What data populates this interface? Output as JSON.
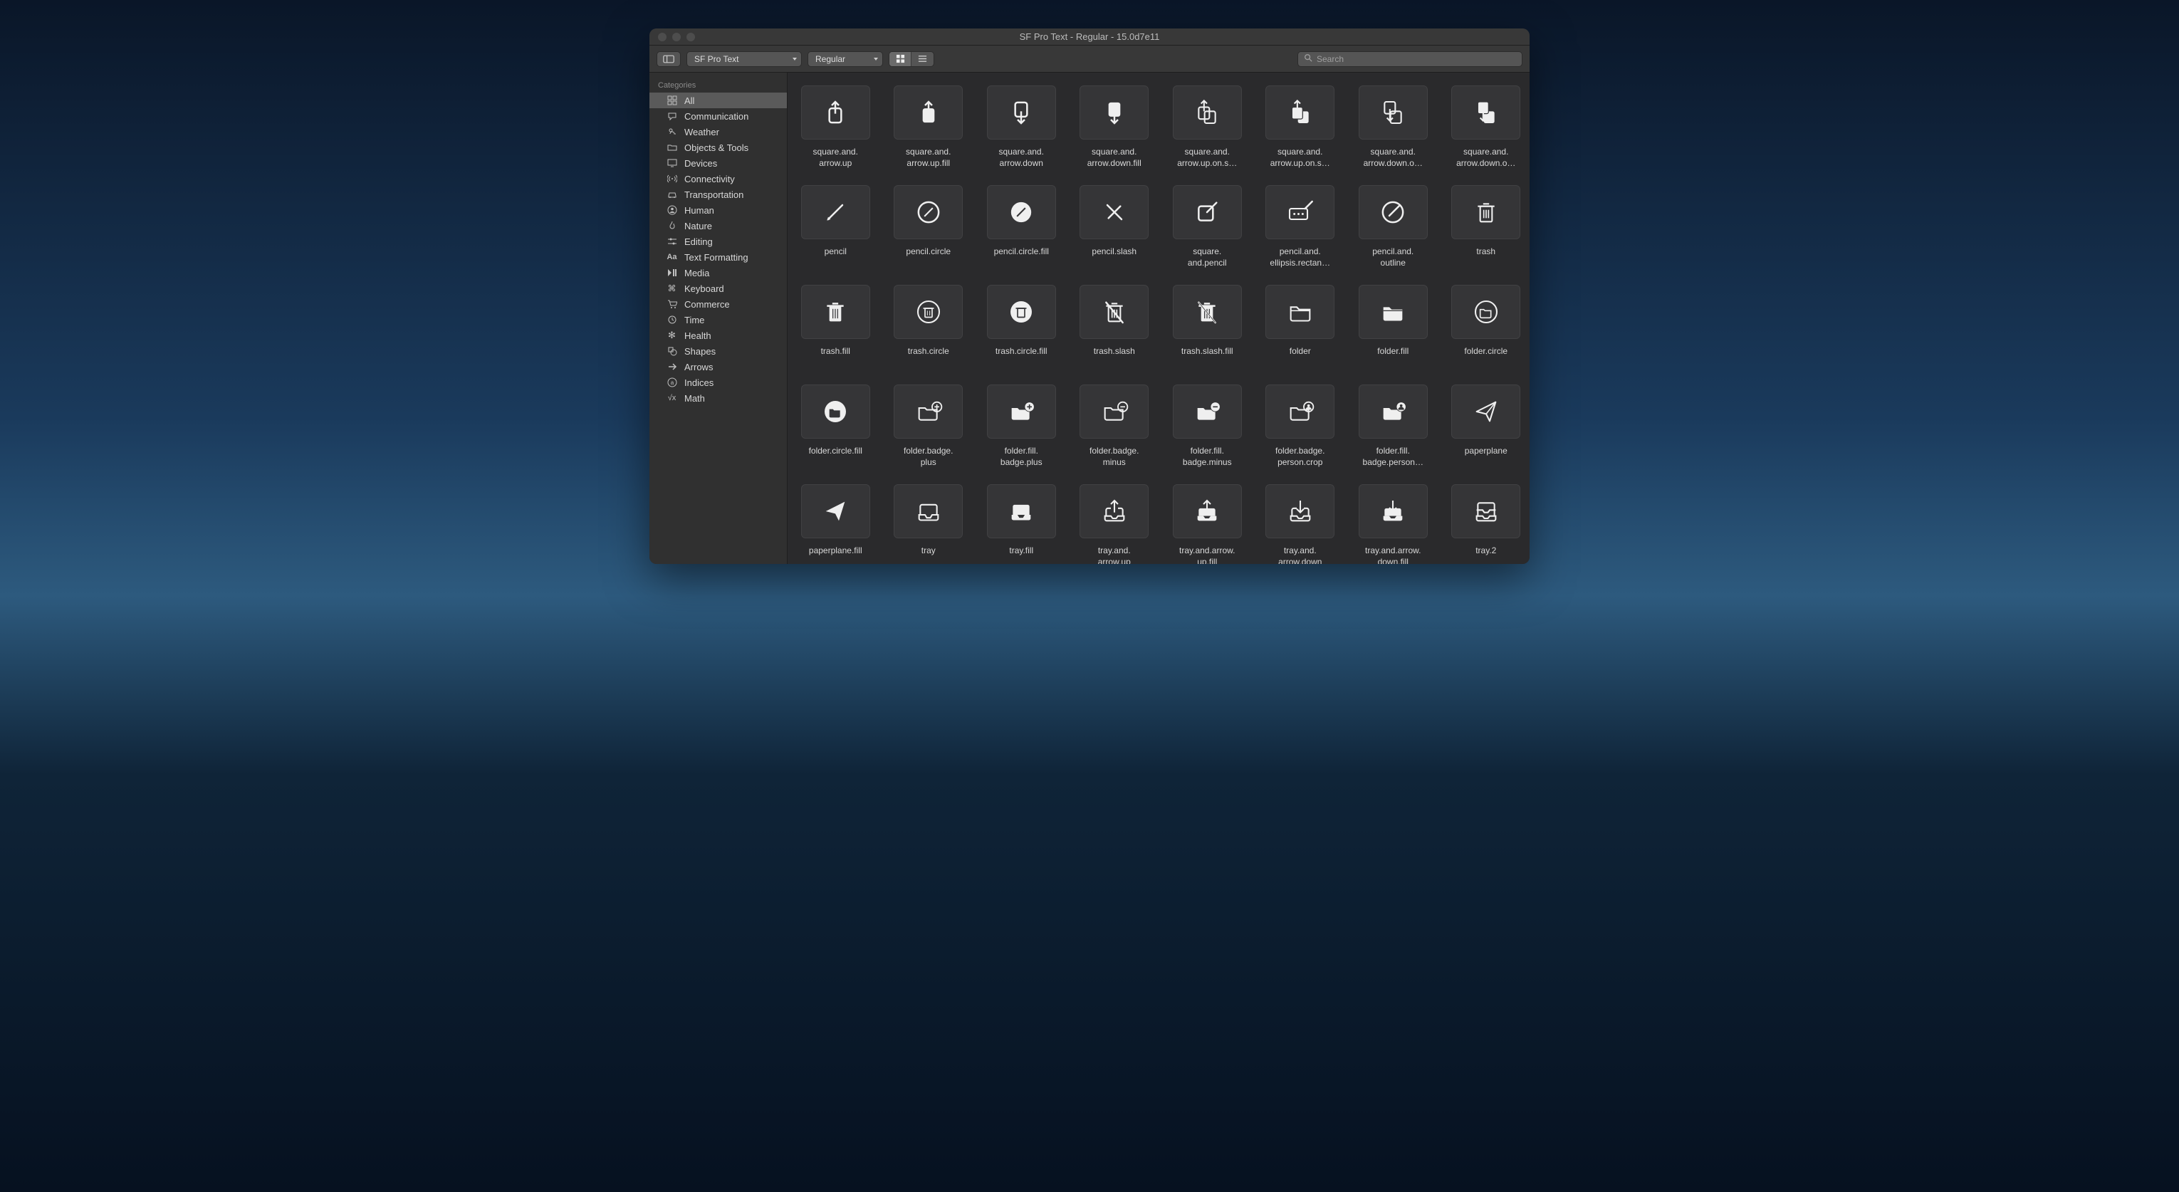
{
  "window_title": "SF Pro Text - Regular - 15.0d7e11",
  "toolbar": {
    "font_select": "SF Pro Text",
    "weight_select": "Regular",
    "search_placeholder": "Search"
  },
  "sidebar": {
    "header": "Categories",
    "items": [
      {
        "label": "All",
        "icon": "grid-icon",
        "active": true
      },
      {
        "label": "Communication",
        "icon": "bubble-icon"
      },
      {
        "label": "Weather",
        "icon": "cloud-sun-icon"
      },
      {
        "label": "Objects & Tools",
        "icon": "folder-icon"
      },
      {
        "label": "Devices",
        "icon": "display-icon"
      },
      {
        "label": "Connectivity",
        "icon": "antenna-icon"
      },
      {
        "label": "Transportation",
        "icon": "car-icon"
      },
      {
        "label": "Human",
        "icon": "person-icon"
      },
      {
        "label": "Nature",
        "icon": "flame-icon"
      },
      {
        "label": "Editing",
        "icon": "slider-icon"
      },
      {
        "label": "Text Formatting",
        "icon": "textformat-icon"
      },
      {
        "label": "Media",
        "icon": "playpause-icon"
      },
      {
        "label": "Keyboard",
        "icon": "command-icon"
      },
      {
        "label": "Commerce",
        "icon": "cart-icon"
      },
      {
        "label": "Time",
        "icon": "clock-arrow-icon"
      },
      {
        "label": "Health",
        "icon": "staroflife-icon"
      },
      {
        "label": "Shapes",
        "icon": "square-on-circle-icon"
      },
      {
        "label": "Arrows",
        "icon": "arrow-right-icon"
      },
      {
        "label": "Indices",
        "icon": "a-circle-icon"
      },
      {
        "label": "Math",
        "icon": "sqrt-icon"
      }
    ]
  },
  "symbols": [
    {
      "name": "square.and.\narrow.up",
      "icon": "square-arrow-up"
    },
    {
      "name": "square.and.\narrow.up.fill",
      "icon": "square-arrow-up-fill"
    },
    {
      "name": "square.and.\narrow.down",
      "icon": "square-arrow-down"
    },
    {
      "name": "square.and.\narrow.down.fill",
      "icon": "square-arrow-down-fill"
    },
    {
      "name": "square.and.\narrow.up.on.s…",
      "icon": "square-arrow-up-on-square"
    },
    {
      "name": "square.and.\narrow.up.on.s…",
      "icon": "square-arrow-up-on-square-fill"
    },
    {
      "name": "square.and.\narrow.down.o…",
      "icon": "square-arrow-down-on-square"
    },
    {
      "name": "square.and.\narrow.down.o…",
      "icon": "square-arrow-down-on-square-fill"
    },
    {
      "name": "pencil",
      "icon": "pencil"
    },
    {
      "name": "pencil.circle",
      "icon": "pencil-circle"
    },
    {
      "name": "pencil.circle.fill",
      "icon": "pencil-circle-fill"
    },
    {
      "name": "pencil.slash",
      "icon": "pencil-slash"
    },
    {
      "name": "square.\nand.pencil",
      "icon": "square-and-pencil"
    },
    {
      "name": "pencil.and.\nellipsis.rectan…",
      "icon": "pencil-ellipsis-rect"
    },
    {
      "name": "pencil.and.\noutline",
      "icon": "pencil-and-outline"
    },
    {
      "name": "trash",
      "icon": "trash"
    },
    {
      "name": "trash.fill",
      "icon": "trash-fill"
    },
    {
      "name": "trash.circle",
      "icon": "trash-circle"
    },
    {
      "name": "trash.circle.fill",
      "icon": "trash-circle-fill"
    },
    {
      "name": "trash.slash",
      "icon": "trash-slash"
    },
    {
      "name": "trash.slash.fill",
      "icon": "trash-slash-fill"
    },
    {
      "name": "folder",
      "icon": "folder"
    },
    {
      "name": "folder.fill",
      "icon": "folder-fill"
    },
    {
      "name": "folder.circle",
      "icon": "folder-circle"
    },
    {
      "name": "folder.circle.fill",
      "icon": "folder-circle-fill"
    },
    {
      "name": "folder.badge.\nplus",
      "icon": "folder-badge-plus"
    },
    {
      "name": "folder.fill.\nbadge.plus",
      "icon": "folder-fill-badge-plus"
    },
    {
      "name": "folder.badge.\nminus",
      "icon": "folder-badge-minus"
    },
    {
      "name": "folder.fill.\nbadge.minus",
      "icon": "folder-fill-badge-minus"
    },
    {
      "name": "folder.badge.\nperson.crop",
      "icon": "folder-badge-person"
    },
    {
      "name": "folder.fill.\nbadge.person…",
      "icon": "folder-fill-badge-person"
    },
    {
      "name": "paperplane",
      "icon": "paperplane"
    },
    {
      "name": "paperplane.fill",
      "icon": "paperplane-fill"
    },
    {
      "name": "tray",
      "icon": "tray"
    },
    {
      "name": "tray.fill",
      "icon": "tray-fill"
    },
    {
      "name": "tray.and.\narrow.up",
      "icon": "tray-arrow-up"
    },
    {
      "name": "tray.and.arrow.\nup.fill",
      "icon": "tray-arrow-up-fill"
    },
    {
      "name": "tray.and.\narrow.down",
      "icon": "tray-arrow-down"
    },
    {
      "name": "tray.and.arrow.\ndown.fill",
      "icon": "tray-arrow-down-fill"
    },
    {
      "name": "tray.2",
      "icon": "tray-2"
    }
  ]
}
